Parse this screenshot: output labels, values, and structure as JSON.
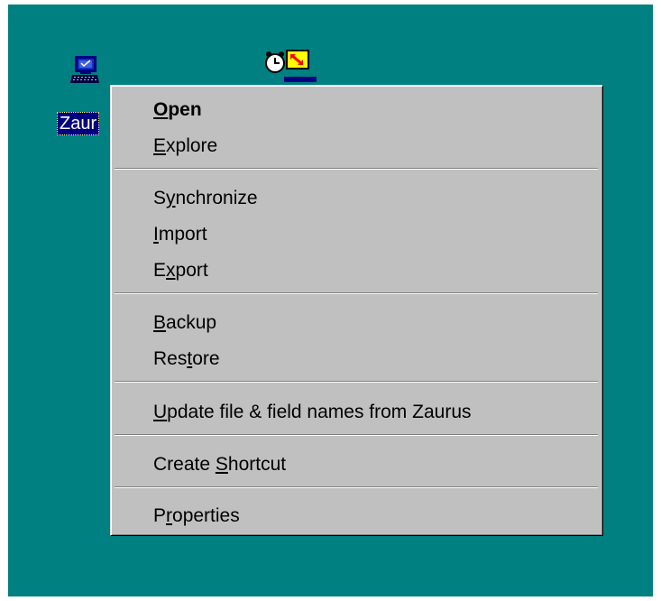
{
  "desktop": {
    "background": "#008080",
    "icons": [
      {
        "name": "Zaurus",
        "label": "Zaur",
        "icon": "pc-terminal-icon",
        "selected": true
      },
      {
        "icon": "sync-alarm-clock-icon",
        "label": ""
      }
    ]
  },
  "context_menu": {
    "items": [
      {
        "pre": "",
        "accel": "O",
        "post": "pen",
        "default": true
      },
      {
        "pre": "",
        "accel": "E",
        "post": "xplore"
      },
      {
        "pre": "S",
        "accel": "y",
        "post": "nchronize"
      },
      {
        "pre": "",
        "accel": "I",
        "post": "mport"
      },
      {
        "pre": "E",
        "accel": "x",
        "post": "port"
      },
      {
        "pre": "",
        "accel": "B",
        "post": "ackup"
      },
      {
        "pre": "Res",
        "accel": "t",
        "post": "ore"
      },
      {
        "pre": "",
        "accel": "U",
        "post": "pdate file & field names from Zaurus"
      },
      {
        "pre": "Create ",
        "accel": "S",
        "post": "hortcut"
      },
      {
        "pre": "P",
        "accel": "r",
        "post": "operties"
      }
    ]
  },
  "colors": {
    "menu_face": "#c0c0c0",
    "selection": "#000080",
    "text": "#000000"
  }
}
